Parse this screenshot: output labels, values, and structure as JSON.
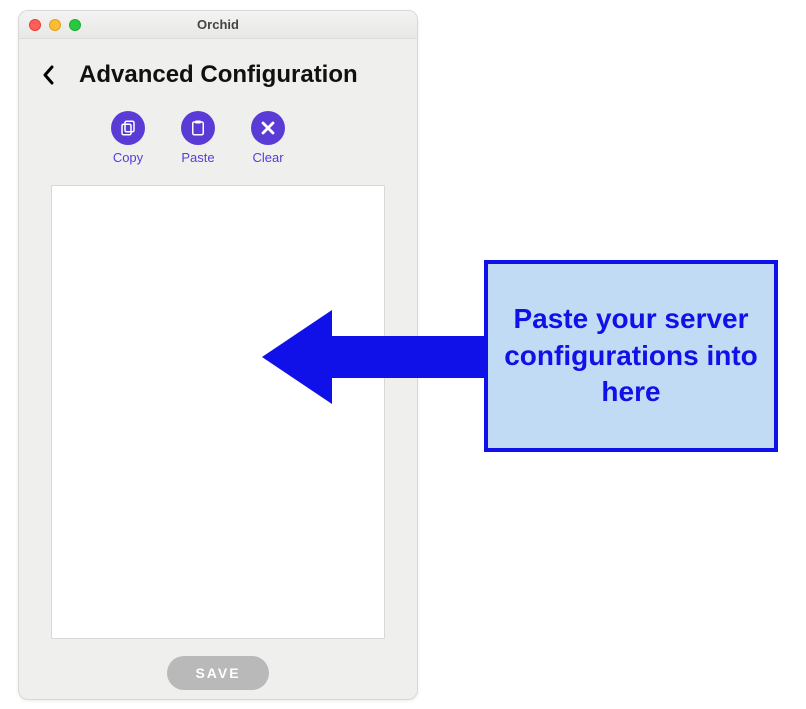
{
  "window": {
    "title": "Orchid"
  },
  "page": {
    "title": "Advanced Configuration"
  },
  "actions": {
    "copy_label": "Copy",
    "paste_label": "Paste",
    "clear_label": "Clear"
  },
  "textarea": {
    "value": "",
    "placeholder": ""
  },
  "save": {
    "label": "SAVE"
  },
  "annotation": {
    "text": "Paste your server configurations into here"
  },
  "colors": {
    "accent": "#5b3bd6",
    "annotation": "#1010e8",
    "annotation_bg": "#c2dbf4"
  }
}
